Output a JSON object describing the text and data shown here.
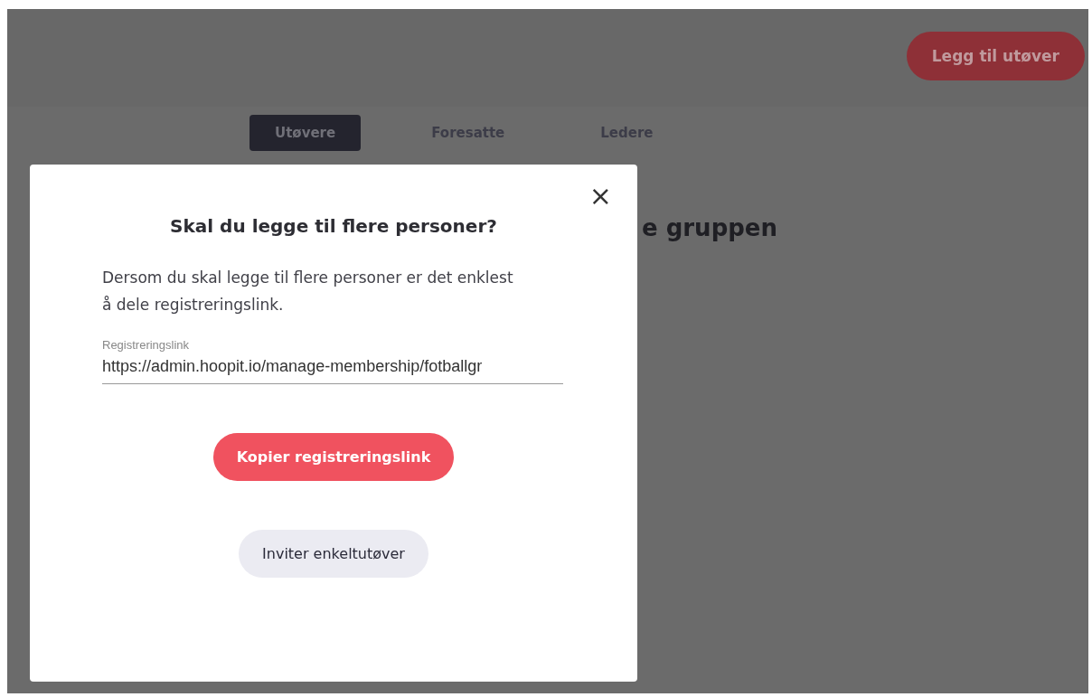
{
  "header": {
    "add_button": "Legg til utøver"
  },
  "tabs": [
    {
      "label": "Utøvere",
      "selected": true
    },
    {
      "label": "Foresatte",
      "selected": false
    },
    {
      "label": "Ledere",
      "selected": false
    }
  ],
  "background_heading": "e gruppen",
  "modal": {
    "close": "×",
    "title": "Skal du legge til flere personer?",
    "text": "Dersom du skal legge til flere personer er det enklest å dele registreringslink.",
    "field": {
      "label": "Registreringslink",
      "value": "https://admin.hoopit.io/manage-membership/fotballgr"
    },
    "buttons": [
      {
        "label": "Kopier registreringslink",
        "kind": "primary"
      },
      {
        "label": "Inviter enkeltutøver",
        "kind": "secondary"
      }
    ]
  }
}
